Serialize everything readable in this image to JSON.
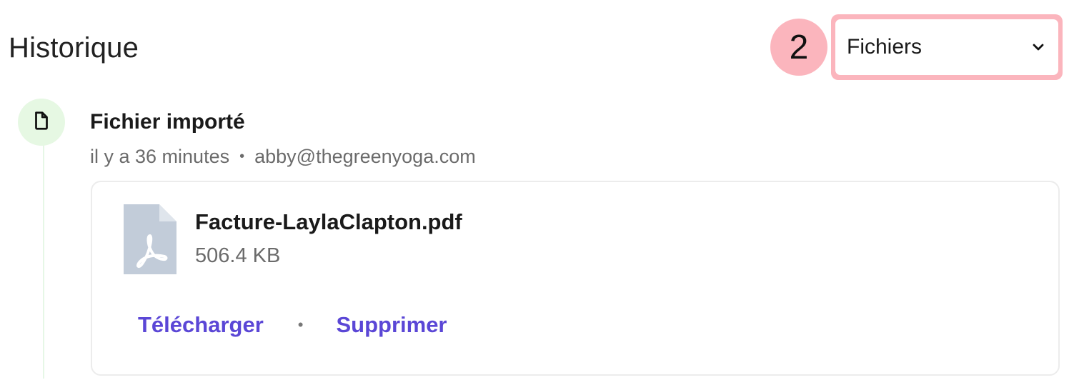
{
  "header": {
    "title": "Historique",
    "step_number": "2",
    "filter": {
      "selected": "Fichiers",
      "icon": "chevron-down-icon"
    }
  },
  "timeline": {
    "events": [
      {
        "icon": "file-icon",
        "title": "Fichier importé",
        "time": "il y a 36 minutes",
        "separator": "•",
        "author": "abby@thegreenyoga.com",
        "file": {
          "icon": "pdf-file-icon",
          "name": "Facture-LaylaClapton.pdf",
          "size": "506.4 KB",
          "actions": {
            "download_label": "Télécharger",
            "separator": "•",
            "delete_label": "Supprimer"
          }
        }
      }
    ]
  },
  "colors": {
    "highlight": "#fbb5bd",
    "link": "#5b47d6",
    "timeline_accent": "#e6f8e3",
    "pdf_icon": "#c2ccd9"
  }
}
